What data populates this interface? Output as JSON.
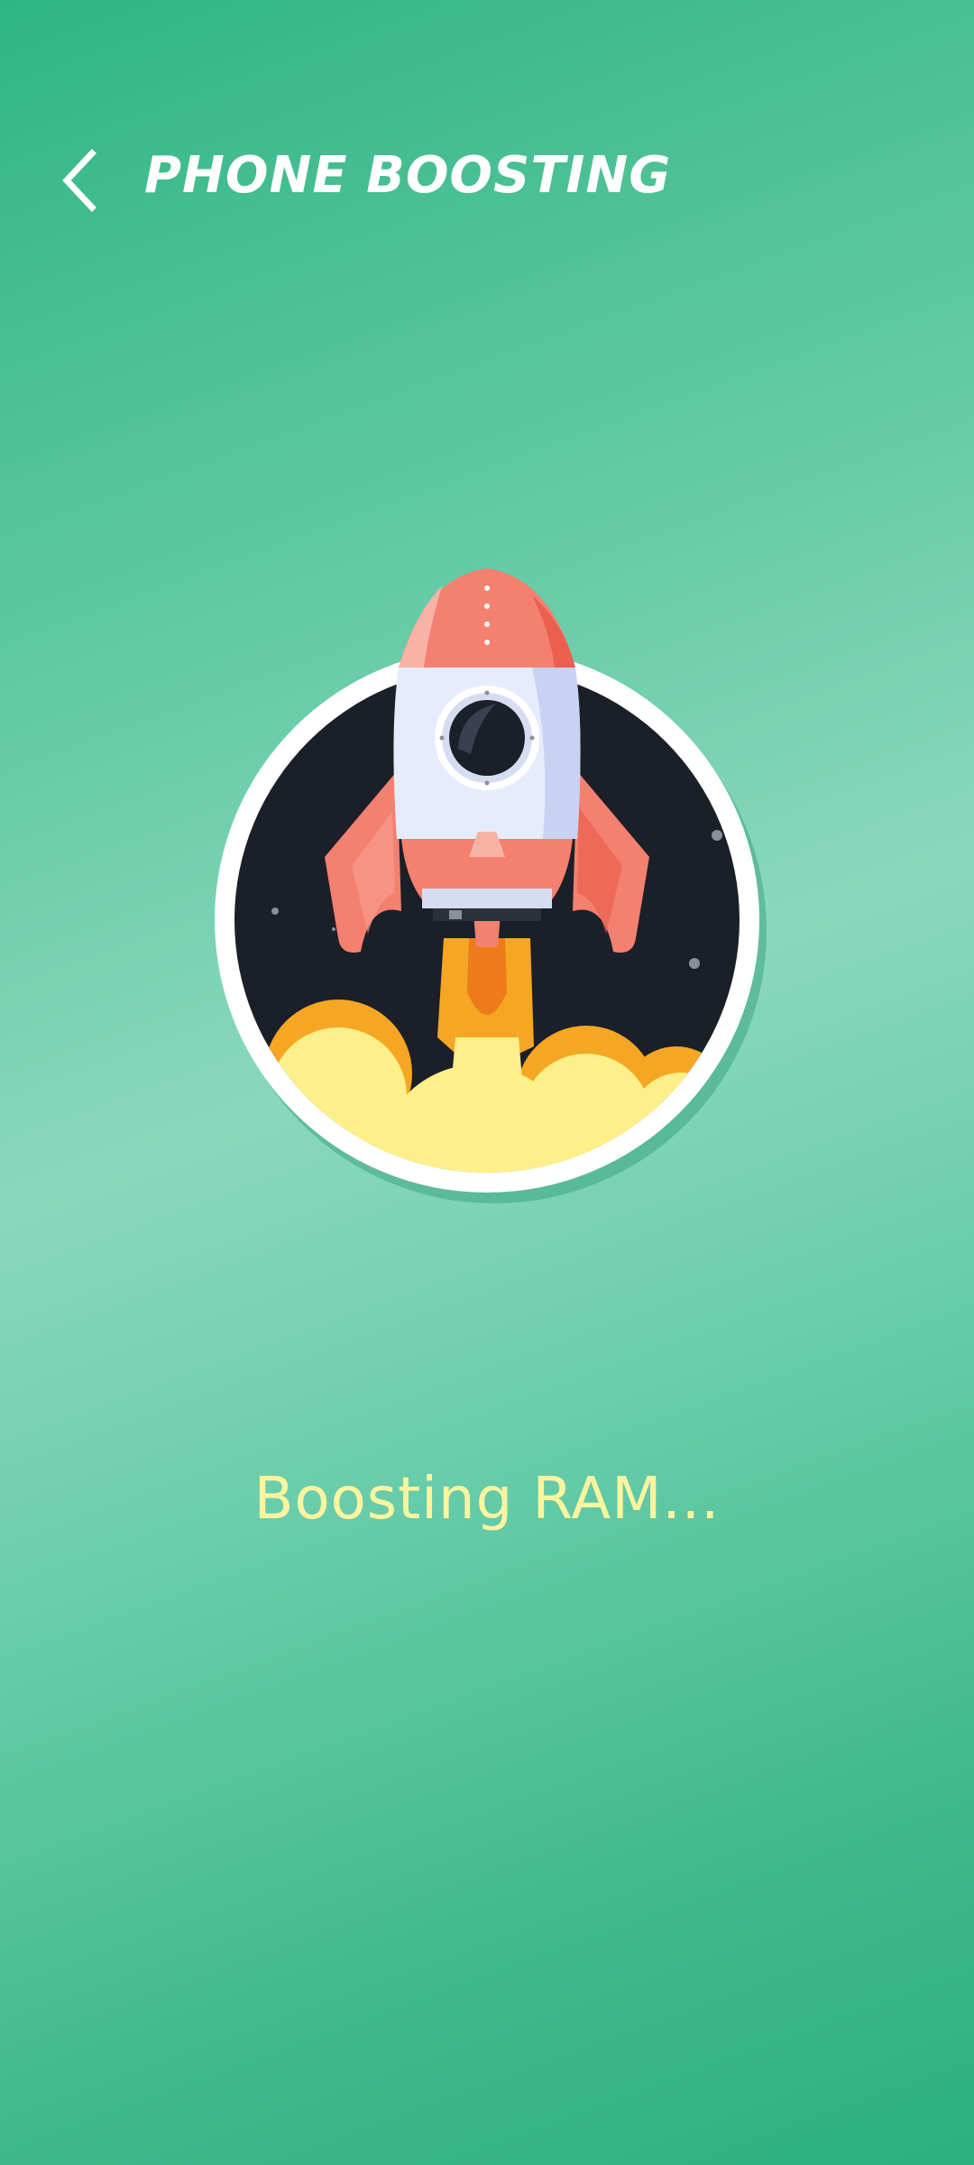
{
  "header": {
    "back_icon": "chevron-left-icon",
    "title": "PHONE BOOSTING"
  },
  "hero": {
    "illustration": "rocket-launch-illustration"
  },
  "status": {
    "text": "Boosting RAM..."
  },
  "colors": {
    "background_top": "#2fb584",
    "background_mid": "#8ad8bd",
    "status_text": "#fdf4a0",
    "rocket_body": "#f4806f",
    "rocket_window": "#e6ecfb",
    "space": "#1b1f28",
    "cloud": "#fdf08a",
    "flame": "#f5a623"
  }
}
